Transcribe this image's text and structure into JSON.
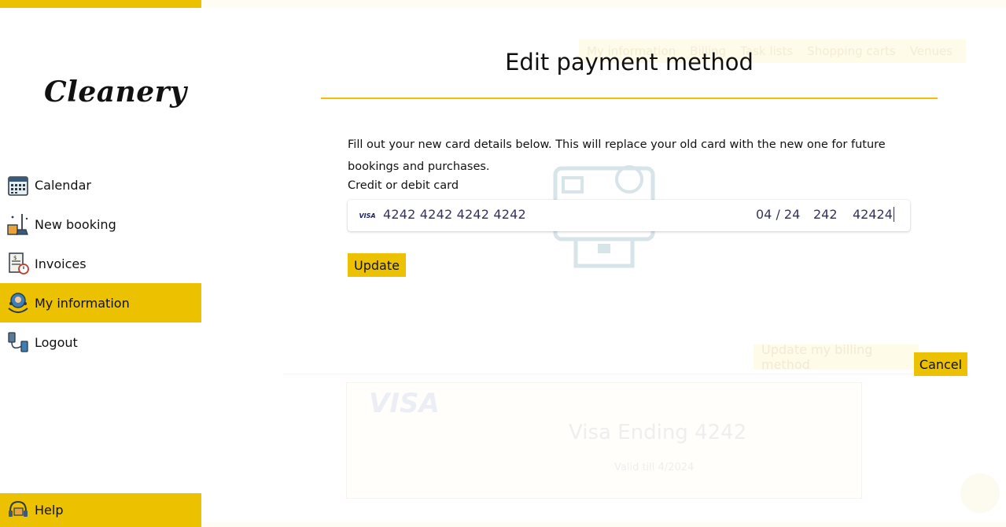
{
  "brand": {
    "logo_text": "Cleanery",
    "accent_color": "#ebc100"
  },
  "sidebar": {
    "items": [
      {
        "label": "Calendar",
        "icon": "calendar-icon"
      },
      {
        "label": "New booking",
        "icon": "cleaning-tools-icon"
      },
      {
        "label": "Invoices",
        "icon": "invoice-icon"
      },
      {
        "label": "My information",
        "icon": "user-headset-icon",
        "active": true
      },
      {
        "label": "Logout",
        "icon": "logout-plug-icon"
      }
    ],
    "help_label": "Help"
  },
  "background": {
    "tabs": [
      "My information",
      "Billing",
      "Task lists",
      "Shopping carts",
      "Venues"
    ],
    "update_billing_label": "Update my billing method",
    "card_brand": "VISA",
    "card_title": "Visa Ending 4242",
    "card_valid": "Valid till 4/2024"
  },
  "modal": {
    "title": "Edit payment method",
    "description": "Fill out your new card details below. This will replace your old card with the new one for future bookings and purchases.",
    "card_label": "Credit or debit card",
    "card": {
      "brand": "VISA",
      "number": "4242 4242 4242 4242",
      "expiry": "04 / 24",
      "cvc": "242",
      "zip": "42424"
    },
    "update_label": "Update",
    "cancel_label": "Cancel"
  }
}
